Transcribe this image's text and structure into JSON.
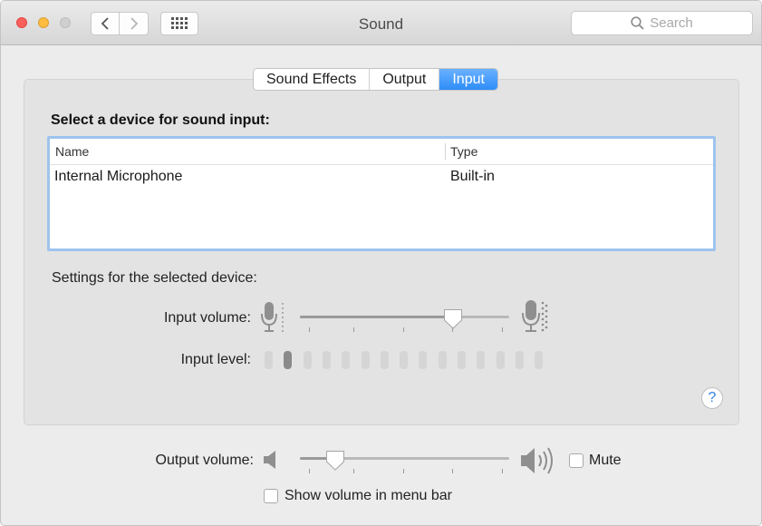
{
  "window": {
    "title": "Sound",
    "search_placeholder": "Search"
  },
  "tabs": [
    {
      "label": "Sound Effects",
      "active": false
    },
    {
      "label": "Output",
      "active": false
    },
    {
      "label": "Input",
      "active": true
    }
  ],
  "input": {
    "section_title": "Select a device for sound input:",
    "table": {
      "columns": [
        "Name",
        "Type"
      ],
      "rows": [
        {
          "name": "Internal Microphone",
          "type": "Built-in"
        }
      ]
    },
    "settings_label": "Settings for the selected device:",
    "input_volume_label": "Input volume:",
    "input_volume_fraction": 0.73,
    "input_level_label": "Input level:",
    "input_level_segments": 15,
    "input_level_active": 1
  },
  "output": {
    "volume_label": "Output volume:",
    "volume_fraction": 0.17,
    "mute_label": "Mute",
    "mute_checked": false,
    "show_in_menu_bar_label": "Show volume in menu bar",
    "show_in_menu_bar_checked": false
  },
  "colors": {
    "accent": "#2e8df8",
    "close": "#fc605c",
    "minimize": "#fdbc40",
    "maximize_disabled": "#cfcfcf"
  },
  "icons": {
    "help": "?",
    "search": "search-icon",
    "back": "chevron-left-icon",
    "forward": "chevron-right-icon",
    "grid": "grid-icon",
    "mic_low": "microphone-low-icon",
    "mic_high": "microphone-high-icon",
    "speaker_low": "speaker-low-icon",
    "speaker_high": "speaker-high-icon"
  }
}
